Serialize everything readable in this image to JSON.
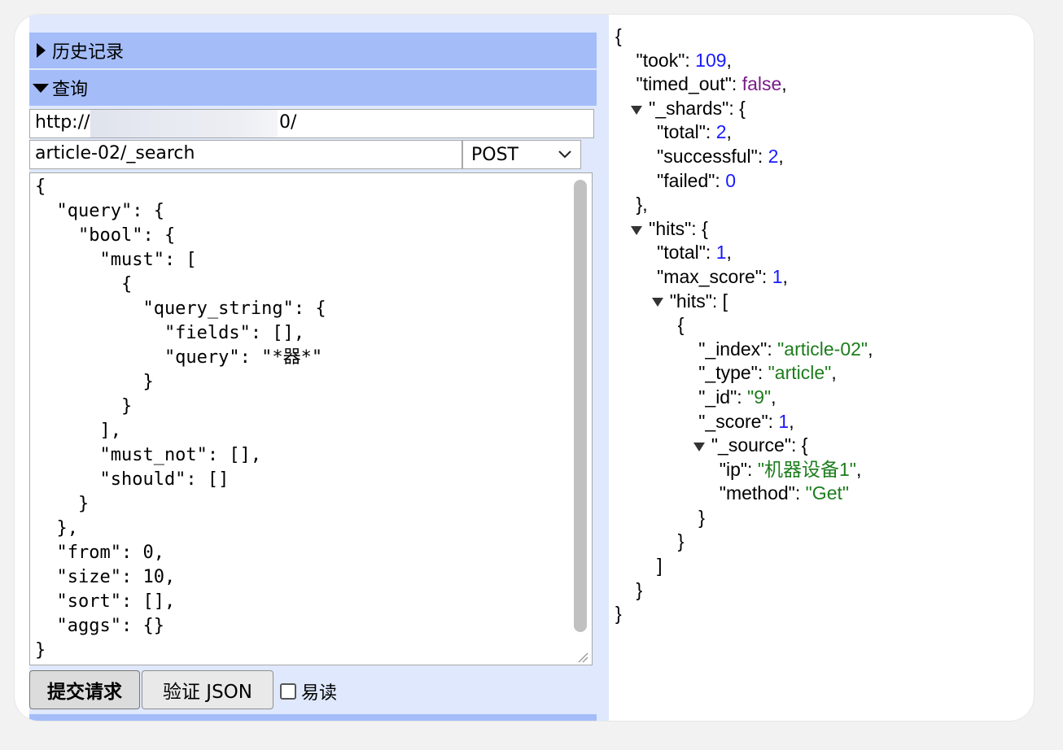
{
  "history": {
    "label": "历史记录"
  },
  "query_section": {
    "label": "查询"
  },
  "url": {
    "value": "http://",
    "suffix": "0/"
  },
  "path": {
    "value": "article-02/_search"
  },
  "method": {
    "selected": "POST"
  },
  "editor": {
    "lines": [
      "{",
      "  \"query\": {",
      "    \"bool\": {",
      "      \"must\": [",
      "        {",
      "          \"query_string\": {",
      "            \"fields\": [],",
      "            \"query\": \"*器*\"",
      "          }",
      "        }",
      "      ],",
      "      \"must_not\": [],",
      "      \"should\": []",
      "    }",
      "  },",
      "  \"from\": 0,",
      "  \"size\": 10,",
      "  \"sort\": [],",
      "  \"aggs\": {}",
      "}"
    ]
  },
  "buttons": {
    "submit": "提交请求",
    "validate": "验证 JSON"
  },
  "readable": {
    "label": "易读"
  },
  "response": {
    "took": "109",
    "timed_out": "false",
    "shards_total": "2",
    "shards_successful": "2",
    "shards_failed": "0",
    "hits_total": "1",
    "hits_max_score": "1",
    "hit_index": "\"article-02\"",
    "hit_type": "\"article\"",
    "hit_id": "\"9\"",
    "hit_score": "1",
    "source_ip": "\"机器设备1\"",
    "source_method": "\"Get\""
  },
  "colors": {
    "header": "#a4bdf9",
    "panel": "#dfe8fc",
    "number": "#1a1aff",
    "string": "#1d7d1d",
    "boolean": "#7a1b8a"
  }
}
